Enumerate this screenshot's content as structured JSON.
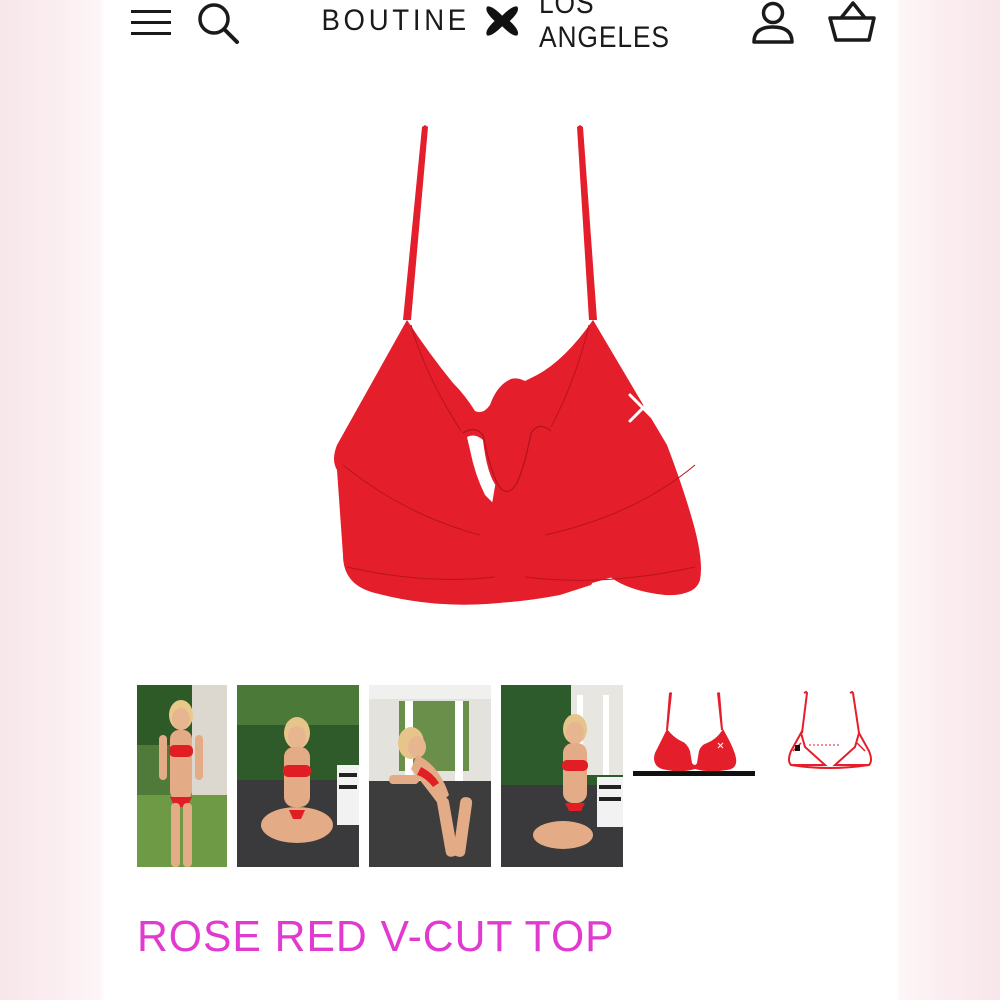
{
  "header": {
    "logo_left": "BOUTINE",
    "logo_right": "LOS ANGELES",
    "icons": [
      "menu-icon",
      "search-icon",
      "account-icon",
      "basket-icon"
    ]
  },
  "product": {
    "title": "ROSE RED V-CUT TOP",
    "title_color": "#e03ad0",
    "garment_color": "#e41e2a",
    "thumbnails": [
      {
        "kind": "photo",
        "name": "model-standing"
      },
      {
        "kind": "photo",
        "name": "model-seated-front"
      },
      {
        "kind": "photo",
        "name": "model-leaning"
      },
      {
        "kind": "photo",
        "name": "model-kneeling"
      },
      {
        "kind": "flat",
        "name": "flat-front",
        "selected": true
      },
      {
        "kind": "flat",
        "name": "flat-back",
        "selected": false
      }
    ]
  }
}
